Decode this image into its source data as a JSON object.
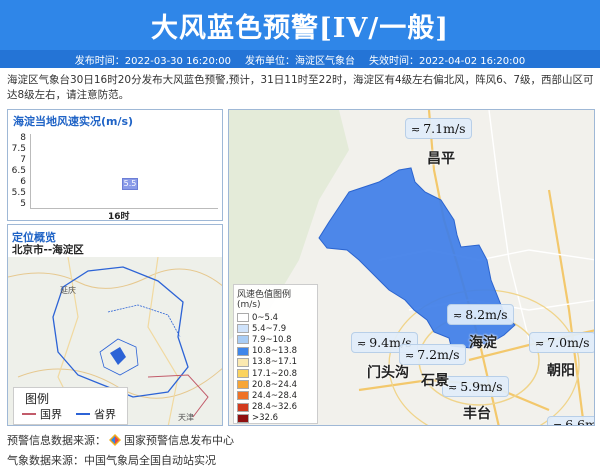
{
  "header": {
    "title": "大风蓝色预警[IV/一般]"
  },
  "meta": {
    "publish_time": "发布时间：2022-03-30 16:20:00",
    "publisher": "发布单位：海淀区气象台",
    "expire_time": "失效时间：2022-04-02 16:20:00"
  },
  "description": "海淀区气象台30日16时20分发布大风蓝色预警,预计，31日11时至22时，海淀区有4级左右偏北风，阵风6、7级，西部山区可达8级左右，请注意防范。",
  "wind_panel": {
    "title": "海淀当地风速实况(m/s)",
    "y_ticks": [
      "8",
      "7.5",
      "7",
      "6.5",
      "6",
      "5.5",
      "5"
    ],
    "marker_value": "5.5",
    "x_label": "16时"
  },
  "location_panel": {
    "title": "定位概览",
    "subtitle": "北京市--海淀区",
    "legend_title": "图例",
    "legend_items": [
      {
        "label": "国界",
        "color": "#c25b6a"
      },
      {
        "label": "省界",
        "color": "#2c63d6"
      }
    ],
    "map_places": [
      "延庆",
      "天津"
    ]
  },
  "main_map": {
    "wind_labels": [
      {
        "value": "7.1m/s"
      },
      {
        "value": "8.2m/s"
      },
      {
        "value": "9.4m/s"
      },
      {
        "value": "7.2m/s"
      },
      {
        "value": "7.0m/s"
      },
      {
        "value": "5.9m/s"
      },
      {
        "value": "6.6m"
      }
    ],
    "places": {
      "changping": "昌平",
      "haidian": "海淀",
      "mentougou": "门头沟",
      "shijingshan": "石景",
      "chaoyang": "朝阳",
      "fengtai": "丰台"
    },
    "color_legend": {
      "title": "风速色值图例 (m/s)",
      "rows": [
        {
          "label": "0~5.4",
          "color": "#ffffff"
        },
        {
          "label": "5.4~7.9",
          "color": "#cfe3fb"
        },
        {
          "label": "7.9~10.8",
          "color": "#a9cdf5"
        },
        {
          "label": "10.8~13.8",
          "color": "#3f86ea"
        },
        {
          "label": "13.8~17.1",
          "color": "#fbe9b0"
        },
        {
          "label": "17.1~20.8",
          "color": "#fbd35e"
        },
        {
          "label": "20.8~24.4",
          "color": "#f7a535"
        },
        {
          "label": "24.4~28.4",
          "color": "#ef7226"
        },
        {
          "label": "28.4~32.6",
          "color": "#d23a1e"
        },
        {
          "label": ">32.6",
          "color": "#8f1010"
        }
      ]
    }
  },
  "footer": {
    "warning_source_label": "预警信息数据来源：",
    "warning_source": "国家预警信息发布中心",
    "weather_source": "气象数据来源：中国气象局全国自动站实况"
  },
  "colors": {
    "header_bg": "#2f86e8",
    "meta_bg": "#2474d6",
    "district_fill": "#3f7ee8"
  },
  "icons": [
    "wind-icon",
    "warning-logo-icon"
  ]
}
